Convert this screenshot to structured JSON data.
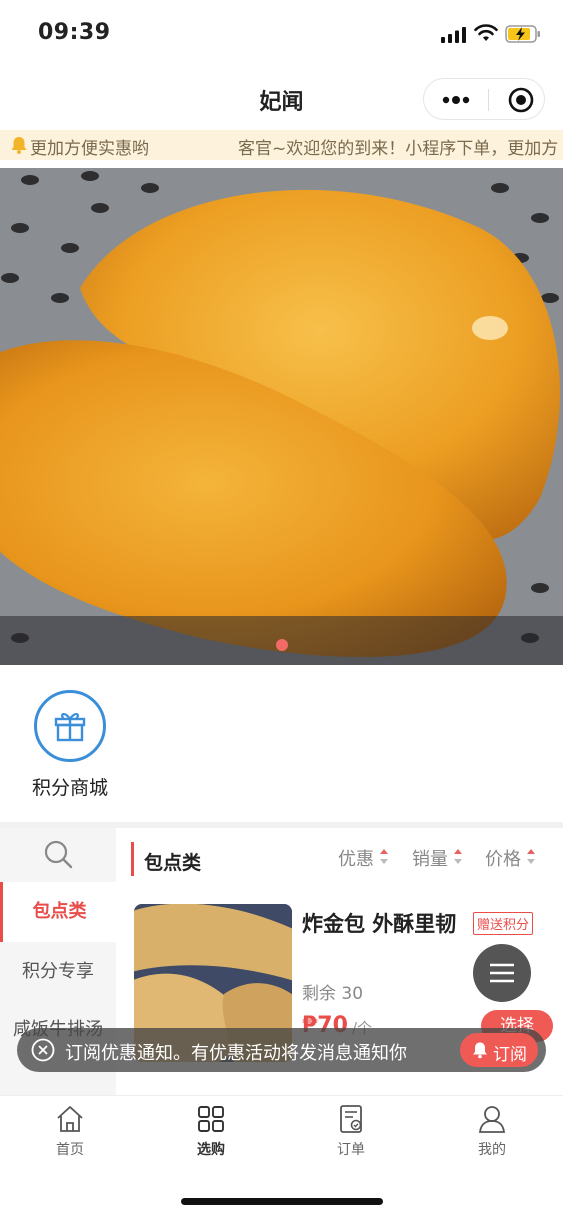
{
  "status_bar": {
    "time": "09:39"
  },
  "nav": {
    "title": "妃闻",
    "more_icon": "more-dots-icon",
    "close_icon": "target-icon"
  },
  "notice": {
    "text_left": "更加方便实惠哟",
    "text_right": "客官~欢迎您的到来！小程序下单，更加方"
  },
  "banner": {
    "dots": 1,
    "active_dot": 0
  },
  "shortcuts": [
    {
      "label": "积分商城",
      "icon": "gift-icon",
      "color": "#3b8fd9"
    }
  ],
  "categories": [
    {
      "label": "包点类",
      "active": true
    },
    {
      "label": "积分专享",
      "active": false
    },
    {
      "label": "咸饭牛排汤",
      "active": false
    }
  ],
  "section": {
    "title": "包点类"
  },
  "sorts": [
    {
      "label": "优惠"
    },
    {
      "label": "销量"
    },
    {
      "label": "价格"
    }
  ],
  "product": {
    "name": "炸金包 外酥里韧",
    "tag": "赠送积分",
    "stock": "剩余 30",
    "price": "₱70",
    "unit": "/个",
    "button": "选择"
  },
  "subscribe": {
    "text": "订阅优惠通知。有优惠活动将发消息通知你",
    "button": "订阅"
  },
  "tabs": [
    {
      "label": "首页",
      "icon": "home-icon",
      "active": false
    },
    {
      "label": "选购",
      "icon": "grid-icon",
      "active": true
    },
    {
      "label": "订单",
      "icon": "order-icon",
      "active": false
    },
    {
      "label": "我的",
      "icon": "user-icon",
      "active": false
    }
  ],
  "colors": {
    "accent": "#e84d4a",
    "blue": "#3b8fd9",
    "notice_bg": "#fdf3dc"
  }
}
